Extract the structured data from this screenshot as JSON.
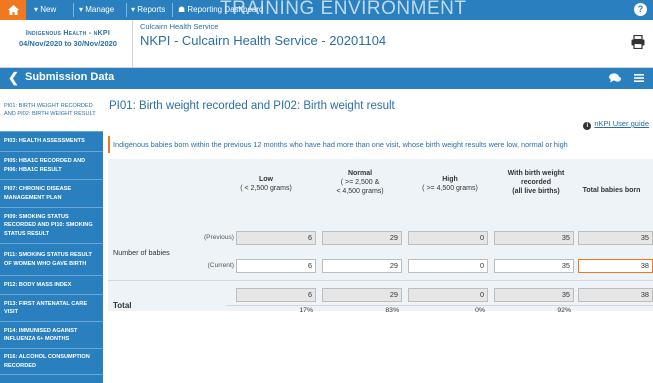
{
  "topbar": {
    "new_label": "New",
    "manage_label": "Manage",
    "reports_label": "Reports",
    "reporting_label": "Reporting Dashboard",
    "watermark": "TRAINING ENVIRONMENT"
  },
  "header": {
    "org_name": "Indigenous Health - nKPI",
    "org_date": "04/Nov/2020 to 30/Nov/2020",
    "service_small": "Culcairn Health Service",
    "service_title": "NKPI - Culcairn Health Service - 20201104"
  },
  "subbar": {
    "title": "Submission Data"
  },
  "sidebar": {
    "items": [
      {
        "label": "PI01: Birth weight recorded and PI02: Birth weight result"
      },
      {
        "label": "PI03: Health assessments"
      },
      {
        "label": "PI05: HbA1c recorded and PI06: HbA1c result"
      },
      {
        "label": "PI07: Chronic disease management plan"
      },
      {
        "label": "PI09: Smoking status recorded and PI10: Smoking status result"
      },
      {
        "label": "PI11: Smoking status result of women who gave birth"
      },
      {
        "label": "PI12: Body mass index"
      },
      {
        "label": "PI13: First antenatal care visit"
      },
      {
        "label": "PI14: Immunised against influenza 6+ months"
      },
      {
        "label": "PI16: Alcohol consumption recorded"
      }
    ]
  },
  "main": {
    "title": "PI01: Birth weight recorded and PI02: Birth weight result",
    "guide_label": "nKPI User guide",
    "description": "Indigenous babies born within the previous 12 months who have had more than one visit, whose birth weight results were low, normal or high",
    "columns": [
      {
        "line1": "Low",
        "line2": "( < 2,500 grams)",
        "line3": ""
      },
      {
        "line1": "Normal",
        "line2": "( >= 2,500 &",
        "line3": "< 4,500 grams)"
      },
      {
        "line1": "High",
        "line2": "( >= 4,500 grams)",
        "line3": ""
      },
      {
        "line1": "With birth weight",
        "line2": "recorded",
        "line3": "(all live births)"
      },
      {
        "line1": "Total babies born",
        "line2": "",
        "line3": ""
      }
    ],
    "row_label": "Number of babies",
    "previous_label": "(Previous)",
    "current_label": "(Current)",
    "previous_values": [
      "6",
      "29",
      "0",
      "35",
      "35"
    ],
    "current_values": [
      "6",
      "29",
      "0",
      "35",
      "38"
    ],
    "total_label": "Total",
    "total_values": [
      "6",
      "29",
      "0",
      "35",
      "38"
    ],
    "percentages": [
      "17%",
      "83%",
      "0%",
      "92%"
    ]
  }
}
